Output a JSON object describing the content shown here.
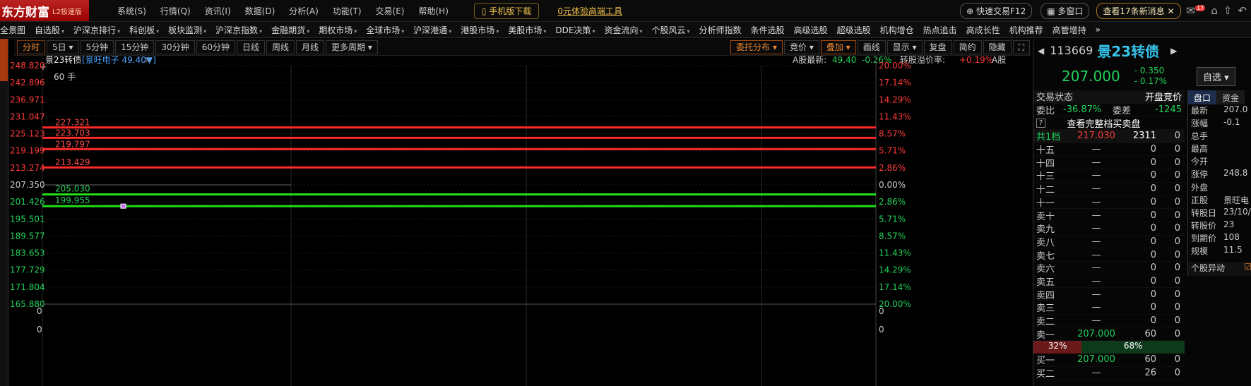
{
  "app": {
    "logo": "东方财富",
    "sub": "L2极速版",
    "menu": [
      "系统(S)",
      "行情(Q)",
      "资讯(I)",
      "数据(D)",
      "分析(A)",
      "功能(T)",
      "交易(E)",
      "帮助(H)"
    ],
    "mobile": "手机版下载",
    "trial": "0元体验高端工具",
    "quicktrade": "快速交易F12",
    "multiwin": "多窗口",
    "msg": "查看17条新消息",
    "badge": "17"
  },
  "nav": [
    [
      "全景图",
      0
    ],
    [
      "自选股",
      1
    ],
    [
      "沪深京排行",
      1
    ],
    [
      "科创板",
      1
    ],
    [
      "板块监测",
      1
    ],
    [
      "沪深京指数",
      1
    ],
    [
      "金融期货",
      1
    ],
    [
      "期权市场",
      1
    ],
    [
      "全球市场",
      1
    ],
    [
      "沪深港通",
      1
    ],
    [
      "港股市场",
      1
    ],
    [
      "美股市场",
      1
    ],
    [
      "DDE决策",
      1
    ],
    [
      "资金流向",
      1
    ],
    [
      "个股风云",
      1
    ],
    [
      "分析师指数",
      0
    ],
    [
      "条件选股",
      0
    ],
    [
      "高级选股",
      0
    ],
    [
      "超级选股",
      0
    ],
    [
      "机构增仓",
      0
    ],
    [
      "热点追击",
      0
    ],
    [
      "高成长性",
      0
    ],
    [
      "机构推荐",
      0
    ],
    [
      "高管增持",
      0
    ],
    [
      "»",
      0
    ]
  ],
  "toolbar": {
    "tabs": [
      "分时",
      "5日",
      "5分钟",
      "15分钟",
      "30分钟",
      "60分钟",
      "日线",
      "周线",
      "月线",
      "更多周期"
    ],
    "right": [
      "委托分布",
      "竞价",
      "叠加",
      "画线",
      "显示",
      "复盘",
      "简约",
      "隐藏"
    ]
  },
  "chart": {
    "name": "景23转债",
    "related": "景旺电子 49.40▼",
    "info_a": "A股最新:",
    "a_price": "49.40",
    "a_chg": "-0.26%",
    "premium_label": "转股溢价率:",
    "premium": "+0.19%",
    "a_tag": "A股",
    "lot": "60 手",
    "left_ticks": [
      "248.820",
      "242.896",
      "236.971",
      "231.047",
      "225.123",
      "219.199",
      "213.274",
      "207.350",
      "201.426",
      "195.501",
      "189.577",
      "183.653",
      "177.729",
      "171.804",
      "165.880"
    ],
    "right_ticks": [
      "20.00%",
      "17.14%",
      "14.29%",
      "11.43%",
      "8.57%",
      "5.71%",
      "2.86%",
      "0.00%",
      "2.86%",
      "5.71%",
      "8.57%",
      "11.43%",
      "14.29%",
      "17.14%",
      "20.00%"
    ],
    "levels_red": [
      "227.321",
      "223.703",
      "219.797",
      "213.429"
    ],
    "levels_green": [
      "205.030",
      "199.955"
    ],
    "vol_tick": "0"
  },
  "quote": {
    "code": "113669",
    "name": "景23转债",
    "price": "207.000",
    "chg": "- 0.350",
    "pct": "- 0.17%",
    "zixuan": "自选",
    "status_label": "交易状态",
    "status": "开盘竞价",
    "wb_label": "委比",
    "wb": "-36.87%",
    "wc_label": "委差",
    "wc": "-1245",
    "full": "查看完整档买卖盘",
    "total": [
      "共1档",
      "217.030",
      "2311",
      "0"
    ],
    "asks": [
      [
        "十五",
        "—",
        "0",
        "0"
      ],
      [
        "十四",
        "—",
        "0",
        "0"
      ],
      [
        "十三",
        "—",
        "0",
        "0"
      ],
      [
        "十二",
        "—",
        "0",
        "0"
      ],
      [
        "十一",
        "—",
        "0",
        "0"
      ],
      [
        "卖十",
        "—",
        "0",
        "0"
      ],
      [
        "卖九",
        "—",
        "0",
        "0"
      ],
      [
        "卖八",
        "—",
        "0",
        "0"
      ],
      [
        "卖七",
        "—",
        "0",
        "0"
      ],
      [
        "卖六",
        "—",
        "0",
        "0"
      ],
      [
        "卖五",
        "—",
        "0",
        "0"
      ],
      [
        "卖四",
        "—",
        "0",
        "0"
      ],
      [
        "卖三",
        "—",
        "0",
        "0"
      ],
      [
        "卖二",
        "—",
        "0",
        "0"
      ],
      [
        "卖一",
        "207.000",
        "60",
        "0"
      ]
    ],
    "ratio": [
      "32%",
      "68%"
    ],
    "bids": [
      [
        "买一",
        "207.000",
        "60",
        "0"
      ],
      [
        "买二",
        "—",
        "26",
        "0"
      ]
    ],
    "side_tabs": [
      "盘口",
      "资金"
    ],
    "side": [
      [
        "最新",
        "207.0"
      ],
      [
        "涨幅",
        "-0.1"
      ],
      [
        "总手",
        ""
      ],
      [
        "最高",
        ""
      ],
      [
        "今开",
        ""
      ],
      [
        "涨停",
        "248.8"
      ],
      [
        "外盘",
        ""
      ],
      [
        "正股",
        "景旺电"
      ],
      [
        "转股日",
        "23/10/"
      ],
      [
        "转股价",
        "23"
      ],
      [
        "到期价",
        "108"
      ],
      [
        "规模",
        "11.5"
      ]
    ],
    "abnormal": "个股异动"
  }
}
